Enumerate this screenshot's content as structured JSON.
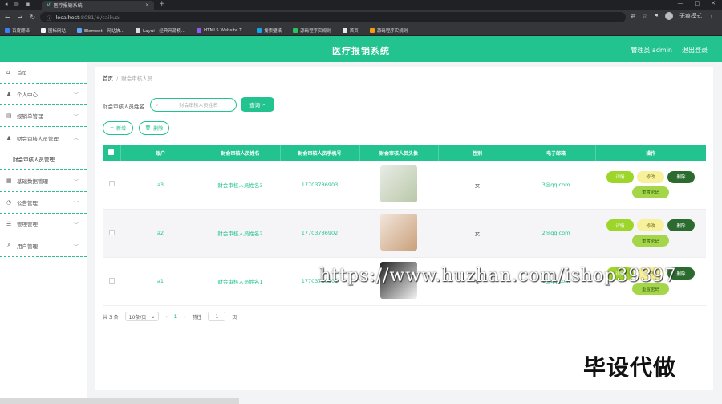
{
  "browser": {
    "tab_title": "医疗报销系统",
    "url_host": "localhost",
    "url_rest": ":8081/#/caikuai",
    "profile_label": "无痕模式",
    "bookmarks": [
      {
        "label": "百度翻译",
        "color": "#3b82f6"
      },
      {
        "label": "图标网站",
        "color": "#f5f5f5"
      },
      {
        "label": "Element - 网站快...",
        "color": "#60a5fa"
      },
      {
        "label": "Layui - 经典开源模...",
        "color": "#dddddd"
      },
      {
        "label": "HTML5 Website T...",
        "color": "#8b5cf6"
      },
      {
        "label": "搜索壁纸",
        "color": "#0ea5e9"
      },
      {
        "label": "源码程序实规则",
        "color": "#22c55e"
      },
      {
        "label": "首页",
        "color": "#e5e7eb"
      },
      {
        "label": "源码程序实规则",
        "color": "#f59e0b"
      }
    ]
  },
  "header": {
    "title": "医疗报销系统",
    "user_label": "管理员 admin",
    "logout_label": "退出登录",
    "color": "#22c38e"
  },
  "sidebar": {
    "items": [
      {
        "label": "首页",
        "icon": "home-icon",
        "expand": false
      },
      {
        "label": "个人中心",
        "icon": "user-icon",
        "expand": true
      },
      {
        "label": "报销单管理",
        "icon": "receipt-icon",
        "expand": true
      },
      {
        "label": "财会审核人员管理",
        "icon": "user-icon",
        "expand": true,
        "submenu": "财会审核人员管理"
      },
      {
        "label": "基础数据管理",
        "icon": "grid-icon",
        "expand": true
      },
      {
        "label": "公告管理",
        "icon": "bell-icon",
        "expand": true
      },
      {
        "label": "管理管理",
        "icon": "list-icon",
        "expand": true
      },
      {
        "label": "用户管理",
        "icon": "users-icon",
        "expand": true
      }
    ]
  },
  "breadcrumb": {
    "home": "首页",
    "separator": "/",
    "current": "财会审核人员"
  },
  "search": {
    "label": "财会审核人员姓名",
    "placeholder": "财会审核人员姓名",
    "button_label": "查询"
  },
  "toolbar": {
    "add_label": "新增",
    "delete_label": "删除"
  },
  "table": {
    "headers": [
      "账户",
      "财会审核人员姓名",
      "财会审核人员手机号",
      "财会审核人员头像",
      "性别",
      "电子邮箱",
      "操作"
    ],
    "rows": [
      {
        "account": "a3",
        "name": "财会审核人员姓名3",
        "phone": "17703786903",
        "gender": "女",
        "email": "3@qq.com",
        "photo_colors": [
          "#e8ece6",
          "#b9c8a8"
        ]
      },
      {
        "account": "a2",
        "name": "财会审核人员姓名2",
        "phone": "17703786902",
        "gender": "女",
        "email": "2@qq.com",
        "photo_colors": [
          "#f3e6dc",
          "#c9a07a"
        ]
      },
      {
        "account": "a1",
        "name": "财会审核人员姓名1",
        "phone": "17703786901",
        "gender": "女",
        "email": "1@qq.com",
        "photo_colors": [
          "#222222",
          "#f4f4f4"
        ]
      }
    ],
    "actions": {
      "detail": "详情",
      "edit": "修改",
      "remove": "删除",
      "reset": "重置密码"
    }
  },
  "pagination": {
    "total": "共 3 条",
    "page_size": "10条/页",
    "prev": "‹",
    "current": "1",
    "next": "›",
    "goto_label": "前往",
    "goto_value": "1",
    "page_unit": "页"
  },
  "overlay": {
    "watermark": "https://www.huzhan.com/ishop39397",
    "caption": "毕设代做"
  }
}
